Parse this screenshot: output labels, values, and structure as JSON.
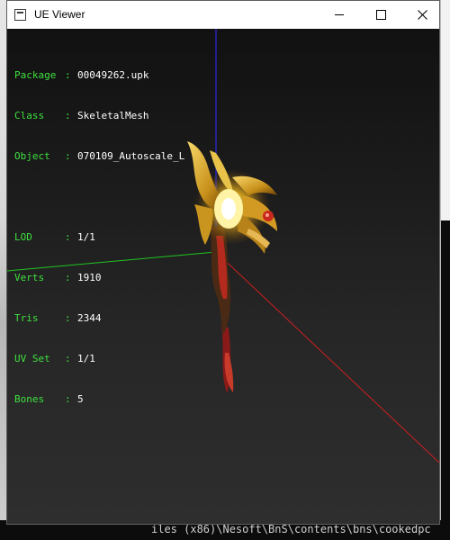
{
  "window": {
    "title": "UE Viewer",
    "controls": {
      "minimize": "minimize",
      "maximize": "maximize",
      "close": "close"
    }
  },
  "info": {
    "separator": ":",
    "package": {
      "label": "Package",
      "value": "00049262.upk"
    },
    "class": {
      "label": "Class",
      "value": "SkeletalMesh"
    },
    "object": {
      "label": "Object",
      "value": "070109_Autoscale_L"
    },
    "lod": {
      "label": "LOD",
      "value": "1/1"
    },
    "verts": {
      "label": "Verts",
      "value": "1910"
    },
    "tris": {
      "label": "Tris",
      "value": "2344"
    },
    "uvset": {
      "label": "UV Set",
      "value": "1/1"
    },
    "bones": {
      "label": "Bones",
      "value": "5"
    }
  },
  "axes": {
    "x_color": "#cc1f1f",
    "y_color": "#22c422",
    "z_color": "#2a2ae0"
  },
  "background": {
    "console_text": "iles (x86)\\Nesoft\\BnS\\contents\\bns\\cookedpc"
  }
}
